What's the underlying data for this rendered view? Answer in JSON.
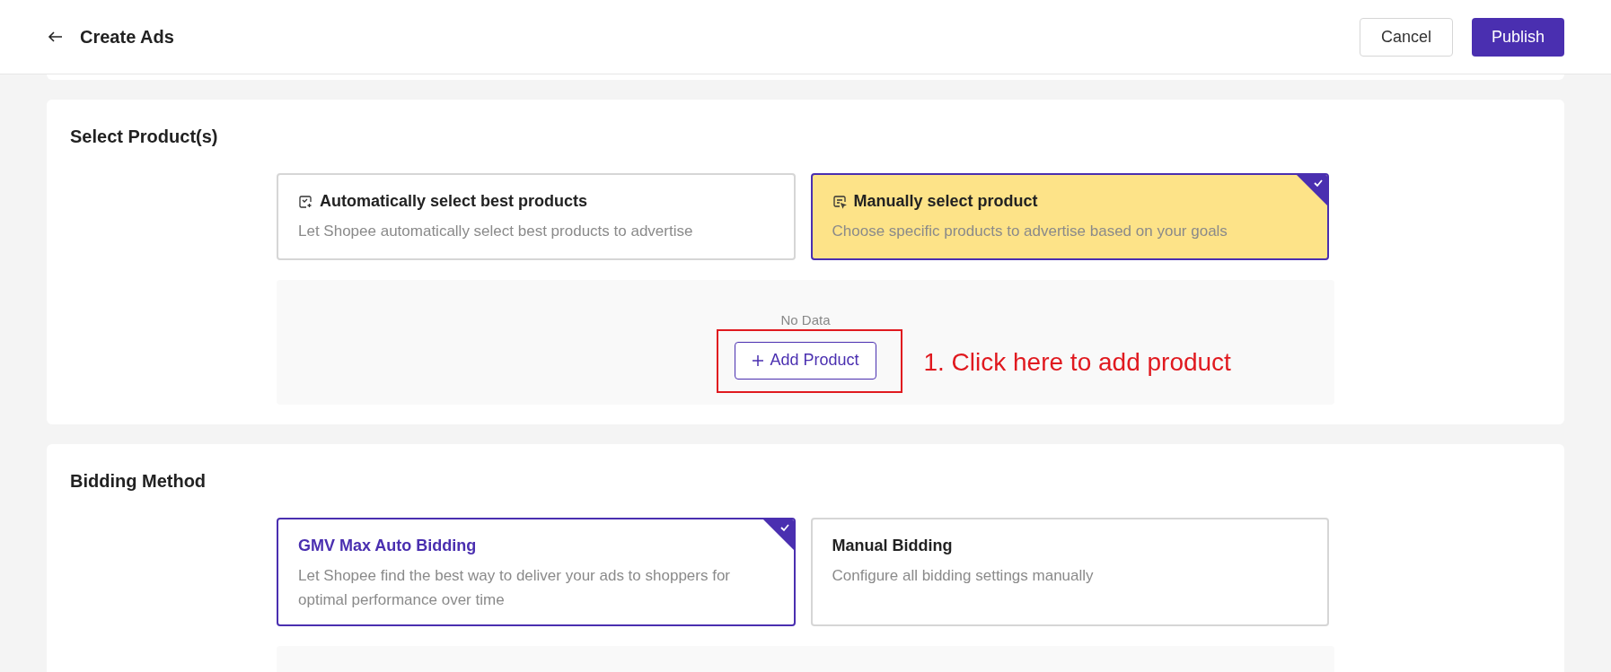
{
  "header": {
    "title": "Create Ads",
    "buttons": [
      {
        "label": "Cancel",
        "kind": "secondary"
      },
      {
        "label": "Publish",
        "kind": "primary"
      }
    ]
  },
  "sections": [
    {
      "title": "Select Product(s)",
      "options": [
        {
          "title": "Automatically select best products",
          "description": "Let Shopee automatically select best products to advertise",
          "selected": false,
          "highlighted": false,
          "kind": "auto"
        },
        {
          "title": "Manually select product",
          "description": "Choose specific products to advertise based on your goals",
          "selected": true,
          "highlighted": true,
          "kind": "manual"
        }
      ],
      "product_list": {
        "empty_text": "No Data",
        "add_button": "Add Product",
        "annotation": "1. Click here to add product"
      }
    },
    {
      "title": "Bidding Method",
      "options": [
        {
          "title": "GMV Max Auto Bidding",
          "description": "Let Shopee find the best way to deliver your ads to shoppers for optimal performance over time",
          "selected": true,
          "highlighted": false
        },
        {
          "title": "Manual Bidding",
          "description": "Configure all bidding settings manually",
          "selected": false,
          "highlighted": false
        }
      ]
    }
  ]
}
